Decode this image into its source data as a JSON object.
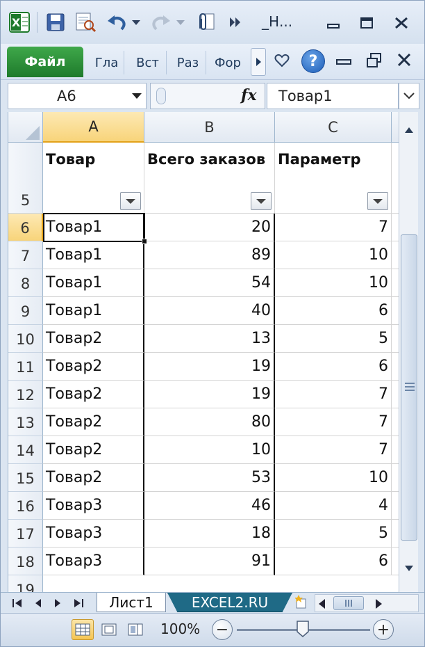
{
  "app": {
    "title": "_Н...",
    "excel_icon_color": "#1e7a2b"
  },
  "ribbon": {
    "file_label": "Файл",
    "tabs": [
      "Гла",
      "Вст",
      "Раз",
      "Фор"
    ]
  },
  "formula_bar": {
    "name_box": "A6",
    "fx_label": "fx",
    "formula": "Товар1"
  },
  "columns": [
    "A",
    "B",
    "C"
  ],
  "header_row": {
    "row_number": "5",
    "cells": [
      "Товар",
      "Всего заказов",
      "Параметр"
    ]
  },
  "rows": [
    {
      "num": "6",
      "product": "Товар1",
      "orders": "20",
      "param": "7"
    },
    {
      "num": "7",
      "product": "Товар1",
      "orders": "89",
      "param": "10"
    },
    {
      "num": "8",
      "product": "Товар1",
      "orders": "54",
      "param": "10"
    },
    {
      "num": "9",
      "product": "Товар1",
      "orders": "40",
      "param": "6"
    },
    {
      "num": "10",
      "product": "Товар2",
      "orders": "13",
      "param": "5"
    },
    {
      "num": "11",
      "product": "Товар2",
      "orders": "19",
      "param": "6"
    },
    {
      "num": "12",
      "product": "Товар2",
      "orders": "19",
      "param": "7"
    },
    {
      "num": "13",
      "product": "Товар2",
      "orders": "80",
      "param": "7"
    },
    {
      "num": "14",
      "product": "Товар2",
      "orders": "10",
      "param": "7"
    },
    {
      "num": "15",
      "product": "Товар2",
      "orders": "53",
      "param": "10"
    },
    {
      "num": "16",
      "product": "Товар3",
      "orders": "46",
      "param": "4"
    },
    {
      "num": "17",
      "product": "Товар3",
      "orders": "18",
      "param": "5"
    },
    {
      "num": "18",
      "product": "Товар3",
      "orders": "91",
      "param": "6"
    }
  ],
  "partial_row": "19",
  "sheets": {
    "active": "Лист1",
    "other": "EXCEL2.RU"
  },
  "status": {
    "zoom": "100%",
    "zoom_out": "−",
    "zoom_in": "+"
  }
}
